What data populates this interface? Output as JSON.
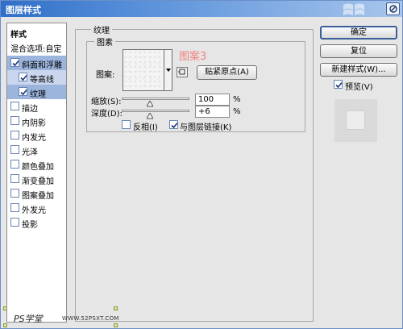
{
  "window": {
    "title": "图层样式",
    "close_label": ""
  },
  "left_panel": {
    "items": [
      {
        "label": "样式",
        "type": "header"
      },
      {
        "label": "混合选项:自定",
        "type": "header"
      },
      {
        "label": "斜面和浮雕",
        "checked": true,
        "selected": true
      },
      {
        "label": "等高线",
        "checked": true,
        "sub": true
      },
      {
        "label": "纹理",
        "checked": true,
        "sub": true
      },
      {
        "label": "描边",
        "checked": false
      },
      {
        "label": "内阴影",
        "checked": false
      },
      {
        "label": "内发光",
        "checked": false
      },
      {
        "label": "光泽",
        "checked": false
      },
      {
        "label": "颜色叠加",
        "checked": false
      },
      {
        "label": "渐变叠加",
        "checked": false
      },
      {
        "label": "图案叠加",
        "checked": false
      },
      {
        "label": "外发光",
        "checked": false
      },
      {
        "label": "投影",
        "checked": false
      }
    ]
  },
  "texture": {
    "group_title": "纹理",
    "pattern_group_title": "图素",
    "pattern_label": "图案:",
    "pattern_name_overlay": "图案3",
    "snap_origin_button": "贴紧原点(A)",
    "scale_label": "缩放(S):",
    "scale_value": "100",
    "scale_unit": "%",
    "scale_level_pct": 42,
    "depth_label": "深度(D):",
    "depth_value": "+6",
    "depth_unit": "%",
    "depth_level_pct": 42,
    "invert_label": "反相(I)",
    "invert_checked": false,
    "link_label": "与图层链接(K)",
    "link_checked": true
  },
  "right_panel": {
    "ok_button": "确定",
    "reset_button": "复位",
    "new_style_button": "新建样式(W)...",
    "preview_label": "预览(V)",
    "preview_checked": true
  },
  "footer": {
    "logo_text": "PS学堂",
    "url_text": "WWW.52PSXT.COM"
  },
  "colors": {
    "titlebar": "#2f6fc8",
    "selected_item": "#9cb5dd",
    "watermark": "#f08080"
  }
}
